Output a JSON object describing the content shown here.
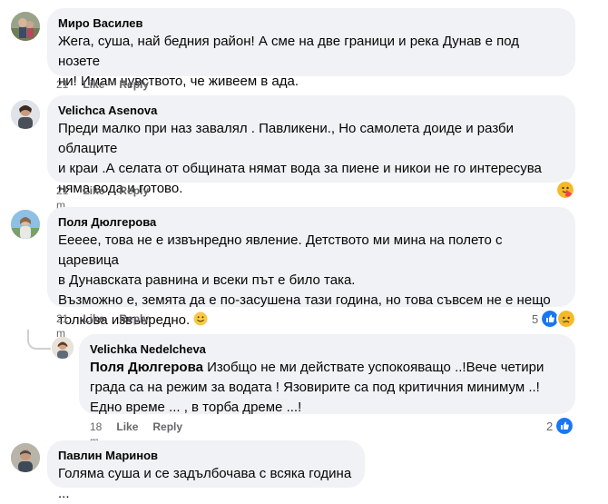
{
  "comments": [
    {
      "author": "Миро Василев",
      "lines": [
        "Жега, суша, най бедния район! А сме на две граници и река Дунав е под нозете",
        "ни! Имам чувството, че живеем в ада."
      ],
      "time": "21 m",
      "like": "Like",
      "reply": "Reply"
    },
    {
      "author": "Velichca Asenova",
      "lines": [
        "Преди малко при наз завалял . Павликени., Но самолета доиде и разби облаците",
        "и краи .А селата от общината нямат вода за пиене и никои не го интересува",
        "няма вода и готово."
      ],
      "time": "21 m",
      "like": "Like",
      "reply": "Reply",
      "reaction_icon": "hug-reaction-icon"
    },
    {
      "author": "Поля Дюлгерова",
      "lines": [
        "Ееееe, това не е извънредно явление. Детството ми мина на полето с царевица",
        "в Дунавската равнина и всеки път е било така.",
        "Възможно е, земята да е по-засушена тази година, но това съвсем не е нещо",
        "толкова извънредно."
      ],
      "time": "21 m",
      "like": "Like",
      "reply": "Reply",
      "reaction_count": "5",
      "reaction_icons": [
        "like-reaction-icon",
        "sad-reaction-icon"
      ]
    },
    {
      "author": "Velichka Nedelcheva",
      "reply_to": "Поля Дюлгерова",
      "lines": [
        " Изобщо не ми действате успокояващо ..!Вече четири",
        "града са на режим за водата ! Язовирите са под критичния минимум ..!",
        "Едно време ... , в торба дреме ...!"
      ],
      "time": "18 m",
      "like": "Like",
      "reply": "Reply",
      "reaction_count": "2",
      "reaction_icons": [
        "like-reaction-icon"
      ]
    },
    {
      "author": "Павлин Маринов",
      "lines": [
        "Голяма суша и се задълбочава с всяка година ..."
      ]
    }
  ],
  "colors": {
    "bubble": "#f0f2f5",
    "meta_text": "#65676b",
    "like_blue": "#1877f2"
  }
}
